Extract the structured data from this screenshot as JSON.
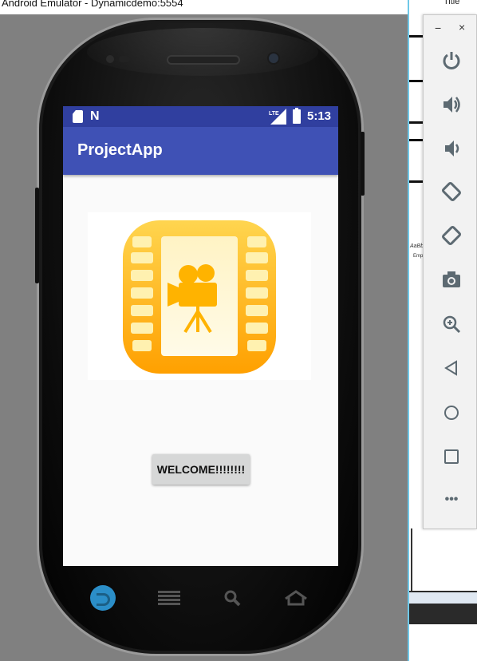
{
  "window": {
    "title": "Android Emulator - Dynamicdemo:5554",
    "background_title": "Title"
  },
  "status_bar": {
    "time": "5:13",
    "network": "LTE"
  },
  "app": {
    "title": "ProjectApp",
    "welcome_button": "WELCOME!!!!!!!!",
    "logo": "film-camera-logo"
  },
  "background_doc": {
    "snippet1": "AaBb",
    "snippet2": "Emp"
  },
  "emulator_toolbar": {
    "minimize": "−",
    "close": "×",
    "buttons": [
      "power-icon",
      "volume-up-icon",
      "volume-down-icon",
      "rotate-left-icon",
      "rotate-right-icon",
      "camera-icon",
      "zoom-icon",
      "back-icon",
      "home-icon",
      "overview-icon",
      "more-icon"
    ],
    "more_label": "•••"
  },
  "colors": {
    "status_bar": "#303f9f",
    "app_bar": "#3f51b5",
    "logo_gold": "#ffc107"
  }
}
